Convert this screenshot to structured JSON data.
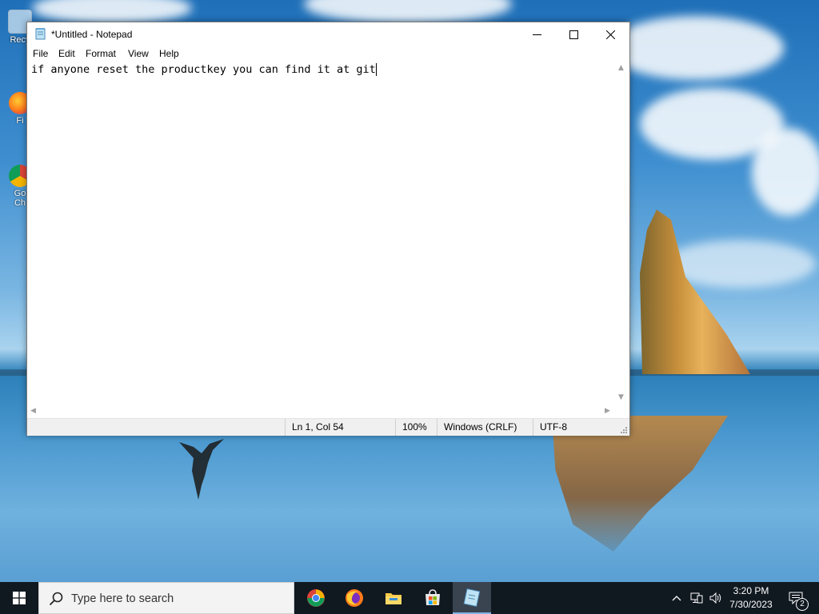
{
  "desktop": {
    "icons": [
      {
        "label": "Recy"
      },
      {
        "label": "Fi"
      },
      {
        "label": "Go"
      },
      {
        "label": "Ch"
      }
    ]
  },
  "notepad": {
    "title": "*Untitled - Notepad",
    "menu": [
      "File",
      "Edit",
      "Format",
      "View",
      "Help"
    ],
    "content": "if anyone reset the productkey you can find it at git",
    "status": {
      "position": "Ln 1, Col 54",
      "zoom": "100%",
      "line_ending": "Windows (CRLF)",
      "encoding": "UTF-8"
    }
  },
  "taskbar": {
    "search_placeholder": "Type here to search",
    "pinned_apps": [
      "chrome-icon",
      "firefox-icon",
      "file-explorer-icon",
      "store-icon",
      "notepad-icon"
    ],
    "clock": {
      "time": "3:20 PM",
      "date": "7/30/2023"
    },
    "notification_count": "2"
  },
  "colors": {
    "taskbar": "#101820",
    "window_border": "#7a7a7a",
    "statusbar": "#f0f0f0"
  }
}
